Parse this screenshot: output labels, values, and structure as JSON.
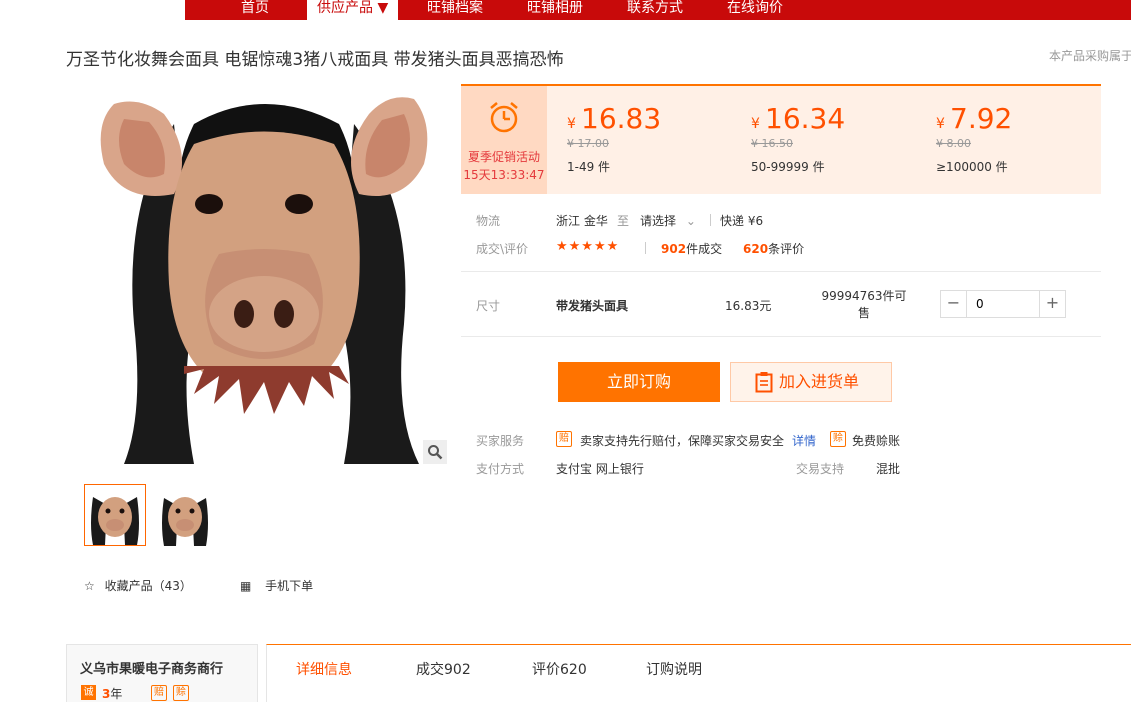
{
  "nav": {
    "items": [
      "首页",
      "供应产品 ▼",
      "旺铺档案",
      "旺铺相册",
      "联系方式",
      "在线询价"
    ]
  },
  "product": {
    "title": "万圣节化妆舞会面具 电锯惊魂3猪八戒面具 带发猪头面具恶搞恐怖",
    "right_note": "本产品采购属于"
  },
  "gallery": {
    "icon": "magnifier-icon"
  },
  "actions": {
    "favorite": "收藏产品（43）",
    "mobile_order": "手机下单"
  },
  "promo": {
    "label": "夏季促销活动",
    "countdown": "15天13:33:47",
    "icon": "alarm-clock-icon"
  },
  "price_tiers": [
    {
      "yen": "¥",
      "price": "16.83",
      "original": "¥ 17.00",
      "range": "1-49 件"
    },
    {
      "yen": "¥",
      "price": "16.34",
      "original": "¥ 16.50",
      "range": "50-99999 件"
    },
    {
      "yen": "¥",
      "price": "7.92",
      "original": "¥ 8.00",
      "range": "≥100000 件"
    }
  ],
  "logistics": {
    "label": "物流",
    "origin": "浙江 金华",
    "to": "至",
    "destination": "请选择",
    "shipping": "快递 ¥6"
  },
  "rating": {
    "label": "成交\\评价",
    "stars": "★★★★★",
    "deals_count": "902",
    "deals_suffix": "件成交",
    "reviews_count": "620",
    "reviews_suffix": "条评价"
  },
  "sku": {
    "label": "尺寸",
    "name": "带发猪头面具",
    "price": "16.83元",
    "stock": "99994763件可售",
    "quantity": "0",
    "minus": "−",
    "plus": "+"
  },
  "buttons": {
    "order": "立即订购",
    "cart": "加入进货单"
  },
  "services": {
    "label": "买家服务",
    "badge1": "赔",
    "text1": "卖家支持先行赔付，保障买家交易安全",
    "details": "详情",
    "badge2": "赊",
    "text2": "免费赊账"
  },
  "payment": {
    "label": "支付方式",
    "methods": "支付宝   网上银行",
    "trade_label": "交易支持",
    "trade_value": "混批"
  },
  "shop": {
    "name": "义乌市果暖电子商务商行",
    "cheng": "诚",
    "years_num": "3",
    "years_unit": "年"
  },
  "tabs": [
    "详细信息",
    "成交902",
    "评价620",
    "订购说明"
  ],
  "colors": {
    "nav_red": "#c80a0a",
    "accent_orange": "#ff7300",
    "price_orange": "#ff5000"
  }
}
